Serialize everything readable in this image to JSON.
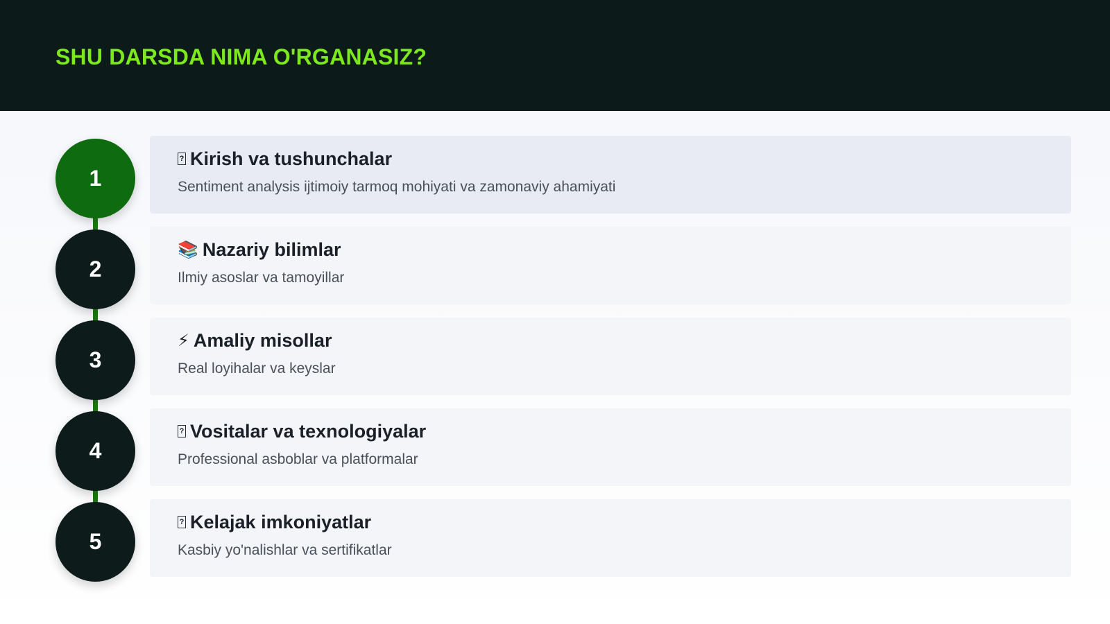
{
  "header": {
    "title": "SHU DARSDA NIMA O'RGANASIZ?"
  },
  "colors": {
    "header_bg": "#0d1a1a",
    "title_accent": "#7ee81f",
    "active_step": "#0f6b0f",
    "inactive_step": "#0e1b1b",
    "connector": "#1d7a10"
  },
  "steps": [
    {
      "number": "1",
      "icon": "missing-glyph-icon",
      "icon_glyph": "?",
      "title": "Kirish va tushunchalar",
      "description": "Sentiment analysis ijtimoiy tarmoq mohiyati va zamonaviy ahamiyati",
      "active": true
    },
    {
      "number": "2",
      "icon": "books-icon",
      "icon_glyph": "📚",
      "title": "Nazariy bilimlar",
      "description": "Ilmiy asoslar va tamoyillar",
      "active": false
    },
    {
      "number": "3",
      "icon": "lightning-icon",
      "icon_glyph": "⚡",
      "title": "Amaliy misollar",
      "description": "Real loyihalar va keyslar",
      "active": false
    },
    {
      "number": "4",
      "icon": "missing-glyph-icon",
      "icon_glyph": "?",
      "title": "Vositalar va texnologiyalar",
      "description": "Professional asboblar va platformalar",
      "active": false
    },
    {
      "number": "5",
      "icon": "missing-glyph-icon",
      "icon_glyph": "?",
      "title": "Kelajak imkoniyatlar",
      "description": "Kasbiy yo'nalishlar va sertifikatlar",
      "active": false
    }
  ]
}
